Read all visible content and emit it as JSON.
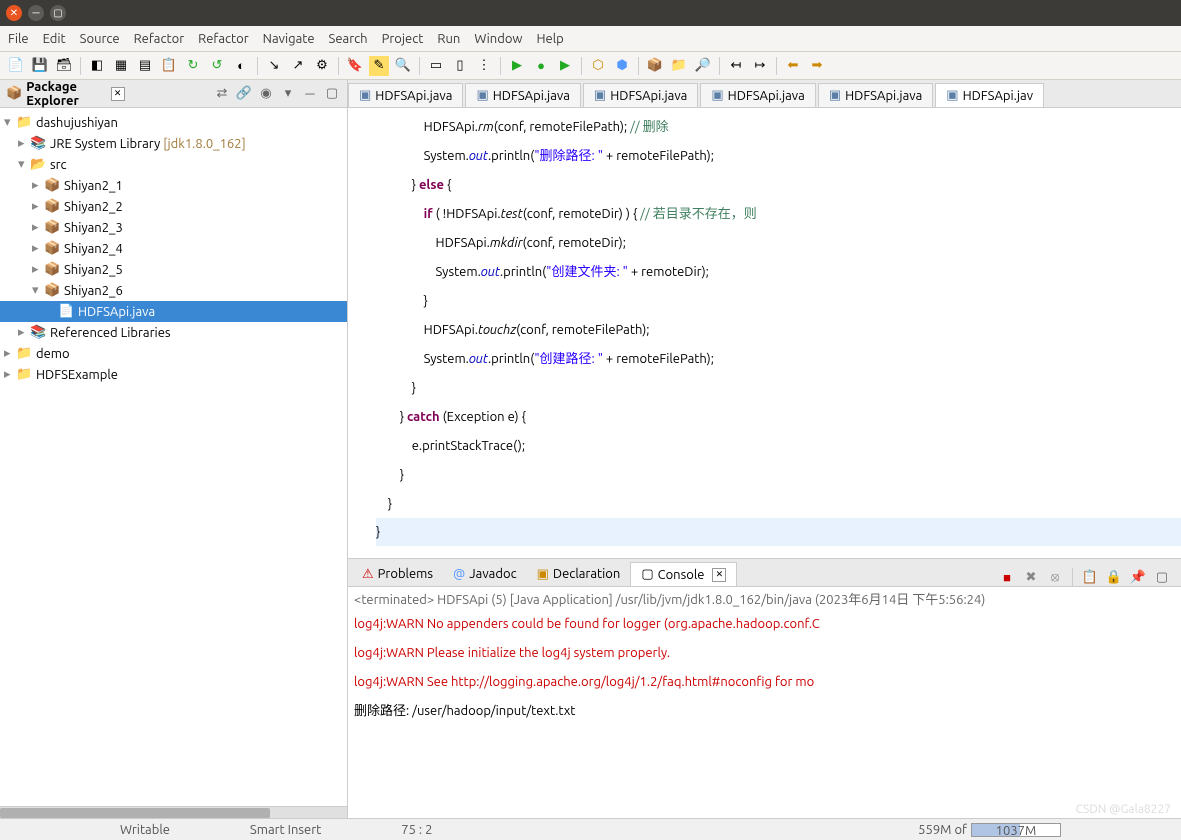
{
  "menu": {
    "file": "File",
    "edit": "Edit",
    "source": "Source",
    "refactor1": "Refactor",
    "refactor2": "Refactor",
    "navigate": "Navigate",
    "search": "Search",
    "project": "Project",
    "run": "Run",
    "window": "Window",
    "help": "Help"
  },
  "package_explorer": {
    "title": "Package Explorer",
    "project": "dashujushiyan",
    "jre": "JRE System Library",
    "jre_ver": "[jdk1.8.0_162]",
    "src": "src",
    "pkgs": [
      "Shiyan2_1",
      "Shiyan2_2",
      "Shiyan2_3",
      "Shiyan2_4",
      "Shiyan2_5",
      "Shiyan2_6"
    ],
    "file": "HDFSApi.java",
    "ref": "Referenced Libraries",
    "demo": "demo",
    "hdfs": "HDFSExample"
  },
  "editor_tabs": [
    "HDFSApi.java",
    "HDFSApi.java",
    "HDFSApi.java",
    "HDFSApi.java",
    "HDFSApi.java",
    "HDFSApi.jav"
  ],
  "code": {
    "l1a": "                HDFSApi.",
    "l1b": "rm",
    "l1c": "(conf, remoteFilePath); ",
    "l1d": "// 删除",
    "l2a": "                System.",
    "l2b": "out",
    "l2c": ".println(",
    "l2d": "\"删除路径: \"",
    "l2e": " + remoteFilePath);",
    "l3": "            } ",
    "l3b": "else",
    "l3c": " {",
    "l4a": "                ",
    "l4b": "if",
    "l4c": " ( !HDFSApi.",
    "l4d": "test",
    "l4e": "(conf, remoteDir) ) { ",
    "l4f": "// 若目录不存在，则",
    "l5a": "                    HDFSApi.",
    "l5b": "mkdir",
    "l5c": "(conf, remoteDir);",
    "l6a": "                    System.",
    "l6b": "out",
    "l6c": ".println(",
    "l6d": "\"创建文件夹: \"",
    "l6e": " + remoteDir);",
    "l7": "                }",
    "l8a": "                HDFSApi.",
    "l8b": "touchz",
    "l8c": "(conf, remoteFilePath);",
    "l9a": "                System.",
    "l9b": "out",
    "l9c": ".println(",
    "l9d": "\"创建路径: \"",
    "l9e": " + remoteFilePath);",
    "l10": "            }",
    "l11a": "        } ",
    "l11b": "catch",
    "l11c": " (Exception e) {",
    "l12": "            e.printStackTrace();",
    "l13": "        }",
    "l14": "    }",
    "l15": "}"
  },
  "bottom_tabs": {
    "problems": "Problems",
    "javadoc": "Javadoc",
    "declaration": "Declaration",
    "console": "Console"
  },
  "console_info": "<terminated> HDFSApi (5) [Java Application] /usr/lib/jvm/jdk1.8.0_162/bin/java (2023年6月14日 下午5:56:24)",
  "console_lines": [
    "log4j:WARN No appenders could be found for logger (org.apache.hadoop.conf.C",
    "log4j:WARN Please initialize the log4j system properly.",
    "log4j:WARN See http://logging.apache.org/log4j/1.2/faq.html#noconfig for mo"
  ],
  "console_out": "删除路径: /user/hadoop/input/text.txt",
  "status": {
    "writable": "Writable",
    "insert": "Smart Insert",
    "pos": "75 : 2",
    "heap": "559M of",
    "heap_max": "1037M"
  },
  "watermark": "CSDN @Gala8227"
}
